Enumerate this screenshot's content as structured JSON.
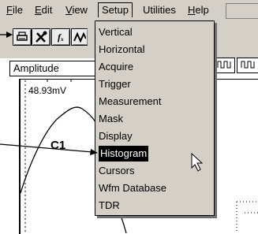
{
  "menubar": {
    "items": [
      {
        "label": "File",
        "underline": "F"
      },
      {
        "label": "Edit",
        "underline": "E"
      },
      {
        "label": "View",
        "underline": "V"
      },
      {
        "label": "Setup",
        "underline": ""
      },
      {
        "label": "Utilities",
        "underline": ""
      },
      {
        "label": "Help",
        "underline": "H"
      }
    ]
  },
  "toolbar": {
    "buttons": [
      {
        "icon": "printer-icon"
      },
      {
        "icon": "tools-icon"
      },
      {
        "icon": "fx-icon",
        "label": "fₓ"
      },
      {
        "icon": "waveform-icon"
      }
    ],
    "dropdown_value": "Amplitude",
    "right_glyphs": [
      "⎍⎍",
      "⎍⎍"
    ]
  },
  "plot": {
    "scale_label": "48.93mV",
    "channel_label": "C1"
  },
  "setup_menu": {
    "items": [
      "Vertical",
      "Horizontal",
      "Acquire",
      "Trigger",
      "Measurement",
      "Mask",
      "Display",
      "Histogram",
      "Cursors",
      "Wfm Database",
      "TDR"
    ],
    "selected": "Histogram"
  },
  "colors": {
    "chrome": "#d4d0c8",
    "selection": "#000000",
    "selection_text": "#ffffff"
  }
}
